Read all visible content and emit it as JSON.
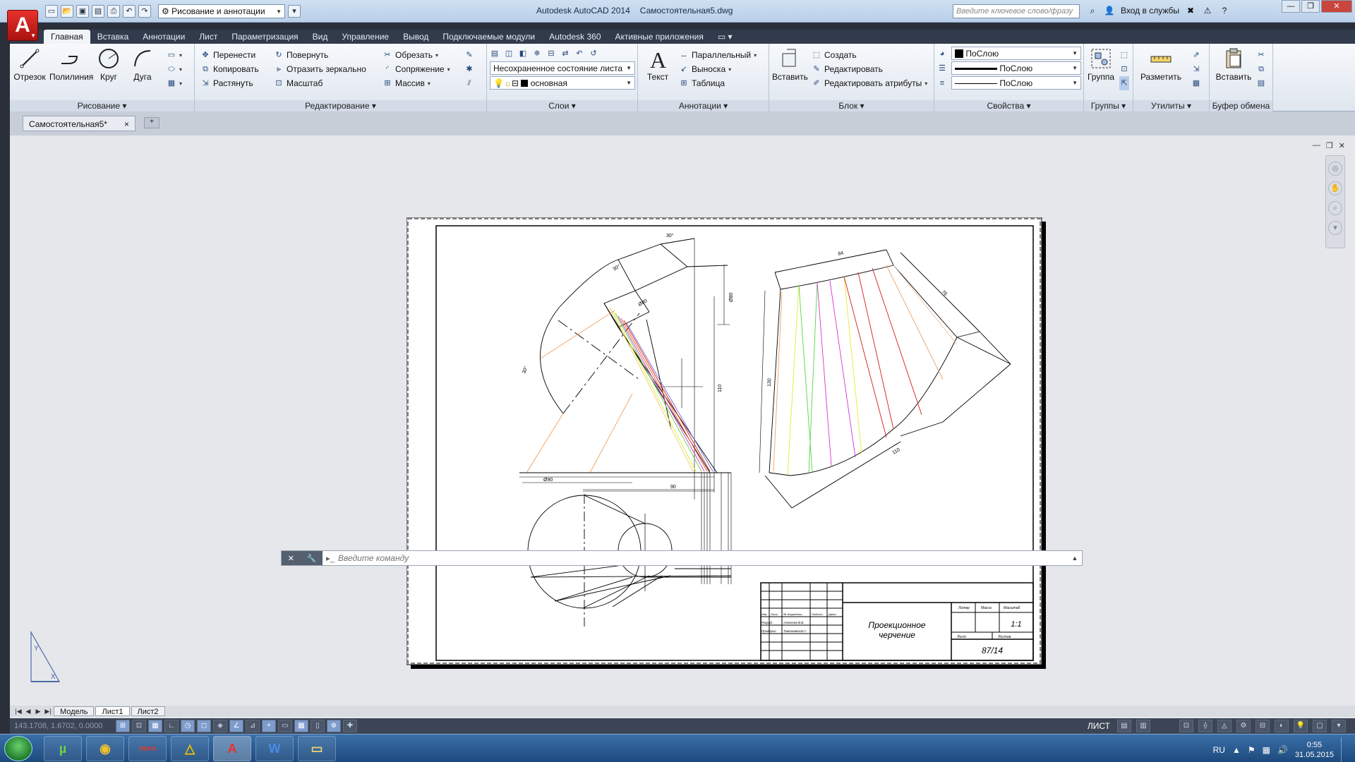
{
  "titlebar": {
    "app_name": "Autodesk AutoCAD 2014",
    "file_name": "Самостоятельная5.dwg",
    "workspace": "Рисование и аннотации",
    "search_placeholder": "Введите ключевое слово/фразу",
    "signin": "Вход в службы",
    "help": "?"
  },
  "ribbon_tabs": [
    "Главная",
    "Вставка",
    "Аннотации",
    "Лист",
    "Параметризация",
    "Вид",
    "Управление",
    "Вывод",
    "Подключаемые модули",
    "Autodesk 360",
    "Активные приложения"
  ],
  "ribbon": {
    "draw": {
      "title": "Рисование",
      "line": "Отрезок",
      "polyline": "Полилиния",
      "circle": "Круг",
      "arc": "Дуга"
    },
    "modify": {
      "title": "Редактирование",
      "move": "Перенести",
      "rotate": "Повернуть",
      "trim": "Обрезать",
      "copy": "Копировать",
      "mirror": "Отразить зеркально",
      "fillet": "Сопряжение",
      "stretch": "Растянуть",
      "scale": "Масштаб",
      "array": "Массив"
    },
    "layers": {
      "title": "Слои",
      "state": "Несохраненное состояние листа",
      "current_layer": "основная"
    },
    "annotation": {
      "title": "Аннотации",
      "text": "Текст",
      "linear": "Параллельный",
      "leader": "Выноска",
      "table": "Таблица"
    },
    "block": {
      "title": "Блок",
      "insert": "Вставить",
      "create": "Создать",
      "edit": "Редактировать",
      "edit_attr": "Редактировать атрибуты"
    },
    "properties": {
      "title": "Свойства",
      "color": "ПоСлою",
      "lineweight": "ПоСлою",
      "linetype": "ПоСлою"
    },
    "groups": {
      "title": "Группы",
      "group": "Группа"
    },
    "utilities": {
      "title": "Утилиты",
      "measure": "Разметить"
    },
    "clipboard": {
      "title": "Буфер обмена",
      "paste": "Вставить"
    }
  },
  "doc_tab": {
    "name": "Самостоятельная5*",
    "close": "×"
  },
  "drawing": {
    "dims": {
      "angle30_top": "30°",
      "angle30_mid": "30°",
      "angle30_left": "30°",
      "d80": "Ø80",
      "d90": "Ø90",
      "h110": "110",
      "w90": "90",
      "top_right": "84",
      "right_dim": "76",
      "left_dim": "130",
      "bottom_dim": "110"
    },
    "title_block": {
      "name_line1": "Проекционное",
      "name_line2": "черчение",
      "scale": "1:1",
      "code": "87/14",
      "col_lit": "Литер",
      "col_mass": "Масса",
      "col_scale": "Масштаб",
      "col_sheet": "Лист",
      "col_sheets": "Листов",
      "row_header": [
        "Изм",
        "Лист",
        "№ документа",
        "Подпись",
        "Дата"
      ],
      "row1": [
        "Разраб.",
        "Алексеев В.В."
      ],
      "row2": [
        "Проверил",
        "Тимошевский Г."
      ]
    }
  },
  "command": {
    "placeholder": "Введите команду",
    "tools_close": "✕",
    "tools_settings": "🔧"
  },
  "layout_tabs": [
    "Модель",
    "Лист1",
    "Лист2"
  ],
  "active_layout": "Лист1",
  "status": {
    "coords": "143.1708, 1.6702, 0.0000",
    "sheet": "ЛИСТ"
  },
  "taskbar": {
    "lang": "RU",
    "time": "0:55",
    "date": "31.05.2015"
  }
}
